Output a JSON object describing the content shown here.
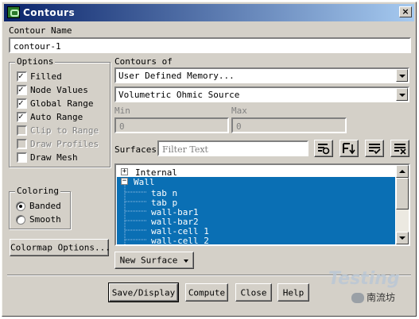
{
  "window": {
    "title": "Contours",
    "close_glyph": "×"
  },
  "contour_name": {
    "label": "Contour Name",
    "value": "contour-1"
  },
  "options": {
    "legend": "Options",
    "items": [
      {
        "label": "Filled",
        "checked": true,
        "enabled": true
      },
      {
        "label": "Node Values",
        "checked": true,
        "enabled": true
      },
      {
        "label": "Global Range",
        "checked": true,
        "enabled": true
      },
      {
        "label": "Auto Range",
        "checked": true,
        "enabled": true
      },
      {
        "label": "Clip to Range",
        "checked": false,
        "enabled": false
      },
      {
        "label": "Draw Profiles",
        "checked": false,
        "enabled": false
      },
      {
        "label": "Draw Mesh",
        "checked": false,
        "enabled": true
      }
    ]
  },
  "coloring": {
    "legend": "Coloring",
    "options": [
      {
        "label": "Banded",
        "selected": true
      },
      {
        "label": "Smooth",
        "selected": false
      }
    ]
  },
  "colormap_button": "Colormap Options...",
  "contours_of": {
    "label": "Contours of",
    "category": "User Defined Memory...",
    "variable": "Volumetric Ohmic Source"
  },
  "range": {
    "min_label": "Min",
    "min_value": "0",
    "max_label": "Max",
    "max_value": "0"
  },
  "surfaces": {
    "label": "Surfaces",
    "filter_placeholder": "Filter Text",
    "tools": [
      "select-all-icon",
      "sort-icon",
      "select-visible-icon",
      "deselect-all-icon"
    ],
    "tree": [
      {
        "label": "Internal",
        "level": 0,
        "expander": "+",
        "selected": false
      },
      {
        "label": "Wall",
        "level": 0,
        "expander": "−",
        "selected": true
      },
      {
        "label": "tab_n",
        "level": 1,
        "selected": true
      },
      {
        "label": "tab_p",
        "level": 1,
        "selected": true
      },
      {
        "label": "wall-bar1",
        "level": 1,
        "selected": true
      },
      {
        "label": "wall-bar2",
        "level": 1,
        "selected": true
      },
      {
        "label": "wall-cell_1",
        "level": 1,
        "selected": true
      },
      {
        "label": "wall-cell_2",
        "level": 1,
        "selected": true
      }
    ]
  },
  "new_surface_button": "New Surface",
  "buttons": {
    "save_display": "Save/Display",
    "compute": "Compute",
    "close": "Close",
    "help": "Help"
  },
  "watermark": {
    "text": "Testing",
    "brand": "南流坊"
  },
  "colors": {
    "title_start": "#0a246a",
    "title_end": "#a6caf0",
    "selection": "#0a6fb4",
    "face": "#d4d0c8"
  }
}
